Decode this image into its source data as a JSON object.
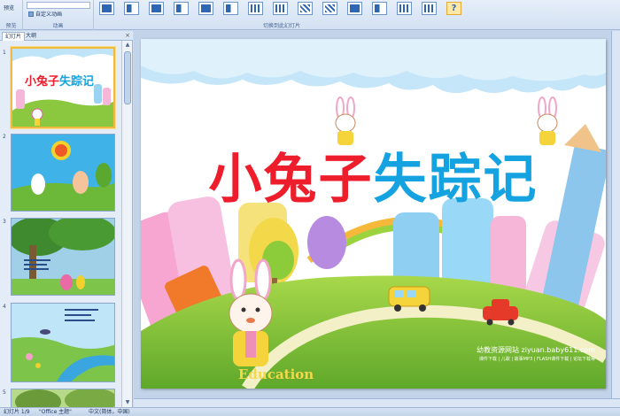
{
  "ribbon": {
    "preview_label": "预览",
    "custom_animation_label": "自定义动画",
    "group_preview": "预览",
    "group_animation": "动画",
    "group_transition": "切换到此幻灯片"
  },
  "panel": {
    "tabs": [
      "幻灯片",
      "大纲"
    ],
    "close_glyph": "×",
    "slide_numbers": [
      "1",
      "2",
      "3",
      "4",
      "5"
    ]
  },
  "slide": {
    "title_red_part": "小兔子",
    "title_blue_part": "失踪记",
    "ground_word": "Education",
    "watermark_line1": "幼教资源网站  ziyuan.baby611.com",
    "watermark_line2": "课件下载 | 儿歌 | 故事MP3 | FLASH课件下载 | 论坛下载等"
  },
  "thumbnails": {
    "thumb1_title": "小兔子失踪记"
  },
  "statusbar": {
    "slide_info": "幻灯片 1/9",
    "theme": "\"Office 主题\"",
    "language": "中文(简体，中国)"
  },
  "icons": {
    "help": "?"
  },
  "colors": {
    "title_red": "#ee1d2c",
    "title_blue": "#14a3e0",
    "selection": "#f2b940"
  }
}
